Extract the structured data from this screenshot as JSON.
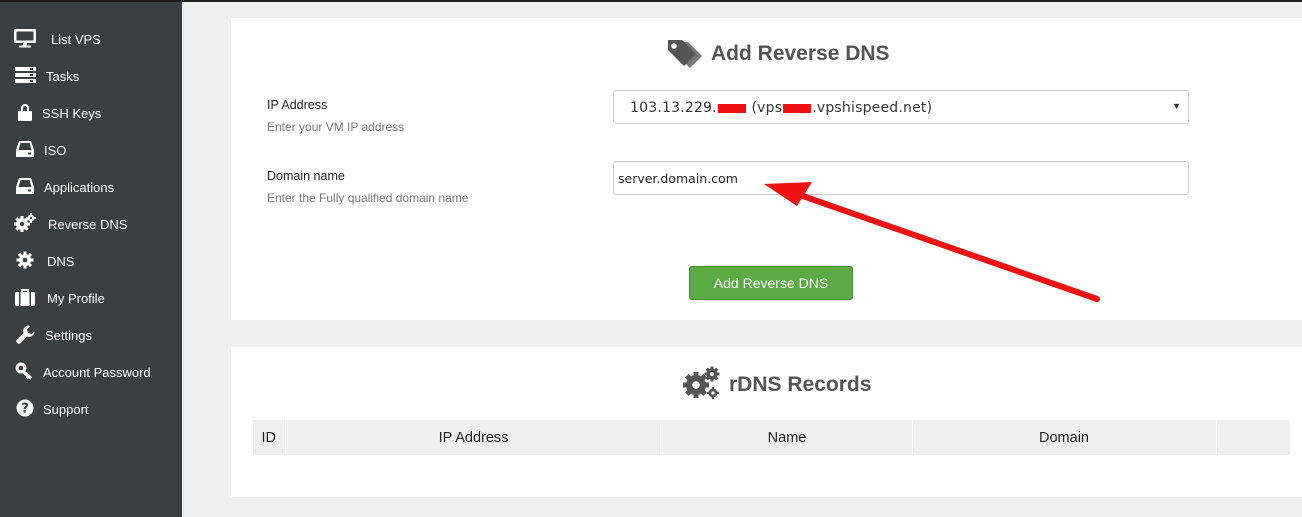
{
  "sidebar": {
    "items": [
      {
        "label": "List VPS",
        "icon": "monitor-icon"
      },
      {
        "label": "Tasks",
        "icon": "tasks-icon"
      },
      {
        "label": "SSH Keys",
        "icon": "lock-icon"
      },
      {
        "label": "ISO",
        "icon": "disk-icon"
      },
      {
        "label": "Applications",
        "icon": "disk-icon"
      },
      {
        "label": "Reverse DNS",
        "icon": "cogs-icon"
      },
      {
        "label": "DNS",
        "icon": "cog-icon"
      },
      {
        "label": "My Profile",
        "icon": "briefcase-icon"
      },
      {
        "label": "Settings",
        "icon": "wrench-icon"
      },
      {
        "label": "Account Password",
        "icon": "key-icon"
      },
      {
        "label": "Support",
        "icon": "question-circle-icon"
      }
    ]
  },
  "add_form": {
    "title": "Add Reverse DNS",
    "ip_label": "IP Address",
    "ip_help": "Enter your VM IP address",
    "ip_value_prefix": "103.13.229.",
    "ip_value_middle": " (vps",
    "ip_value_suffix": ".vpshispeed.net)",
    "domain_label": "Domain name",
    "domain_help": "Enter the Fully qualified domain name",
    "domain_value": "server.domain.com",
    "submit_label": "Add Reverse DNS"
  },
  "records": {
    "title": "rDNS Records",
    "columns": [
      "ID",
      "IP Address",
      "Name",
      "Domain",
      ""
    ]
  },
  "colors": {
    "sidebar_bg": "#3b3f3f",
    "button_green": "#5cab42",
    "annotation_red": "#ee1111"
  }
}
